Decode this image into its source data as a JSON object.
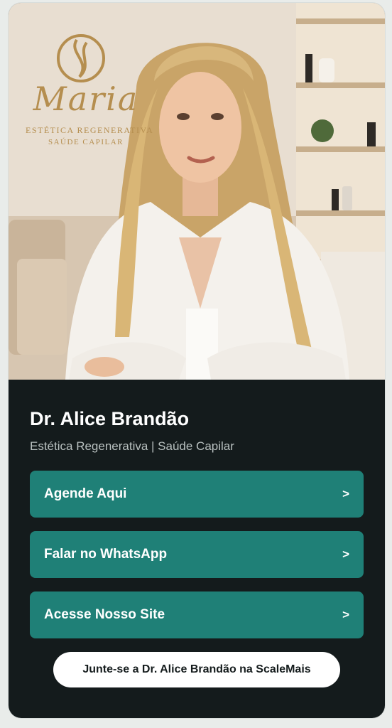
{
  "hero": {
    "logo_script": "Maria",
    "logo_line1": "ESTÉTICA REGENERATIVA",
    "logo_line2": "SAÚDE CAPILAR"
  },
  "profile": {
    "name": "Dr. Alice Brandão",
    "subtitle": "Estética Regenerativa | Saúde Capilar"
  },
  "links": [
    {
      "label": "Agende Aqui",
      "arrow": ">"
    },
    {
      "label": "Falar no WhatsApp",
      "arrow": ">"
    },
    {
      "label": "Acesse Nosso Site",
      "arrow": ">"
    }
  ],
  "join_button": "Junte-se a Dr. Alice Brandão na ScaleMais",
  "colors": {
    "card_bg": "#141b1c",
    "button_teal": "#1f8077",
    "logo_gold": "#b58e4f"
  }
}
